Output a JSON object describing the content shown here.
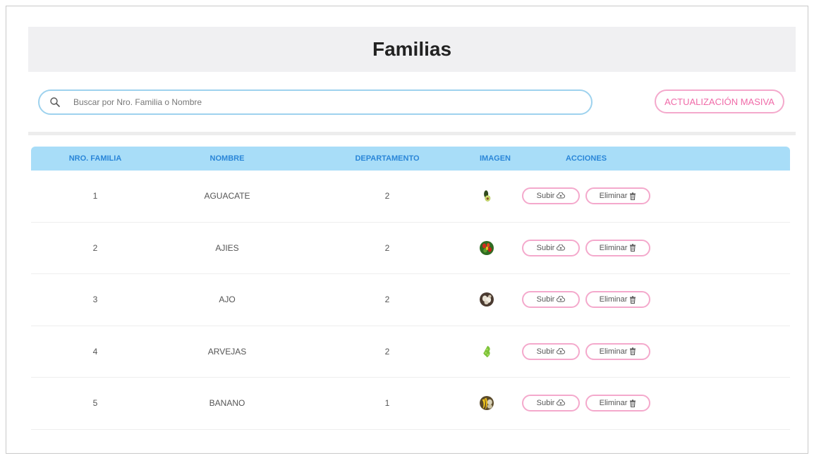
{
  "header": {
    "title": "Familias"
  },
  "search": {
    "placeholder": "Buscar por Nro. Familia o Nombre"
  },
  "toolbar": {
    "bulk_update_label": "ACTUALIZACIÓN MASIVA"
  },
  "table": {
    "columns": [
      "NRO. FAMILIA",
      "NOMBRE",
      "DEPARTAMENTO",
      "IMAGEN",
      "ACCIONES"
    ],
    "rows": [
      {
        "nro": "1",
        "nombre": "AGUACATE",
        "departamento": "2",
        "image_icon": "avocado-image"
      },
      {
        "nro": "2",
        "nombre": "AJIES",
        "departamento": "2",
        "image_icon": "peppers-image"
      },
      {
        "nro": "3",
        "nombre": "AJO",
        "departamento": "2",
        "image_icon": "garlic-image"
      },
      {
        "nro": "4",
        "nombre": "ARVEJAS",
        "departamento": "2",
        "image_icon": "peas-image"
      },
      {
        "nro": "5",
        "nombre": "BANANO",
        "departamento": "1",
        "image_icon": "banana-image"
      }
    ],
    "actions": {
      "upload_label": "Subir",
      "delete_label": "Eliminar"
    }
  },
  "colors": {
    "header_bg": "#a8ddf8",
    "header_text": "#2a86d8",
    "accent_pink": "#f4a9cc",
    "search_border": "#9ed2ee"
  }
}
